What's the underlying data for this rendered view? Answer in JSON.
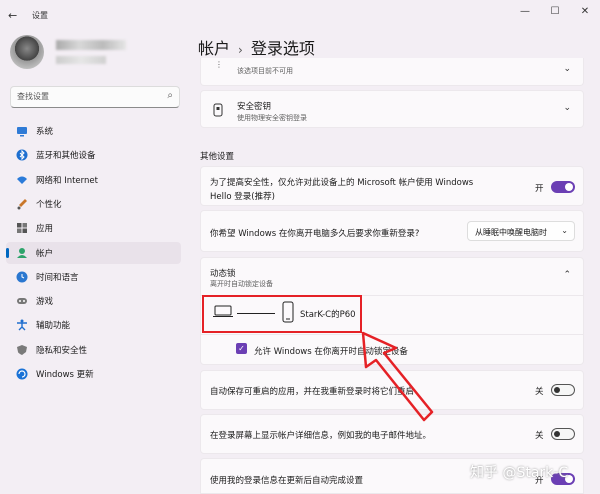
{
  "app": {
    "title": "设置"
  },
  "search": {
    "placeholder": "查找设置"
  },
  "nav": {
    "items": [
      {
        "label": "系统",
        "icon": "monitor-icon"
      },
      {
        "label": "蓝牙和其他设备",
        "icon": "bluetooth-icon"
      },
      {
        "label": "网络和 Internet",
        "icon": "wifi-icon"
      },
      {
        "label": "个性化",
        "icon": "brush-icon"
      },
      {
        "label": "应用",
        "icon": "apps-icon"
      },
      {
        "label": "帐户",
        "icon": "person-icon",
        "active": true
      },
      {
        "label": "时间和语言",
        "icon": "globe-clock-icon"
      },
      {
        "label": "游戏",
        "icon": "gamepad-icon"
      },
      {
        "label": "辅助功能",
        "icon": "accessibility-icon"
      },
      {
        "label": "隐私和安全性",
        "icon": "shield-icon"
      },
      {
        "label": "Windows 更新",
        "icon": "update-icon"
      }
    ]
  },
  "breadcrumb": {
    "parent": "帐户",
    "current": "登录选项"
  },
  "cards": {
    "top_partial_sub": "该选项目前不可用",
    "security_key": {
      "title": "安全密钥",
      "sub": "使用物理安全密钥登录"
    }
  },
  "other_settings": {
    "section_title": "其他设置",
    "hello_only": {
      "line1": "为了提高安全性，仅允许对此设备上的 Microsoft 帐户使用 Windows",
      "line2": "Hello 登录(推荐)",
      "state": "开"
    },
    "require_signin": {
      "text": "你希望 Windows 在你离开电脑多久后要求你重新登录?",
      "dropdown_value": "从睡眠中唤醒电脑时"
    },
    "dynamic_lock": {
      "title": "动态锁",
      "sub": "离开时自动锁定设备",
      "device_name": "StarK-C的P60",
      "checkbox_label": "允许 Windows 在你离开时自动锁定设备"
    },
    "restart_apps": {
      "text": "自动保存可重启的应用，并在我重新登录时将它们重启",
      "state": "关"
    },
    "show_account": {
      "text": "在登录屏幕上显示帐户详细信息，例如我的电子邮件地址。",
      "state": "关"
    },
    "use_signin_info": {
      "text": "使用我的登录信息在更新后自动完成设置",
      "state": "开"
    }
  },
  "watermark": "知乎 @Stark-C",
  "colors": {
    "accent": "#6b3fb4",
    "annotation_red": "#e52126",
    "nav_indicator": "#0067c0"
  }
}
